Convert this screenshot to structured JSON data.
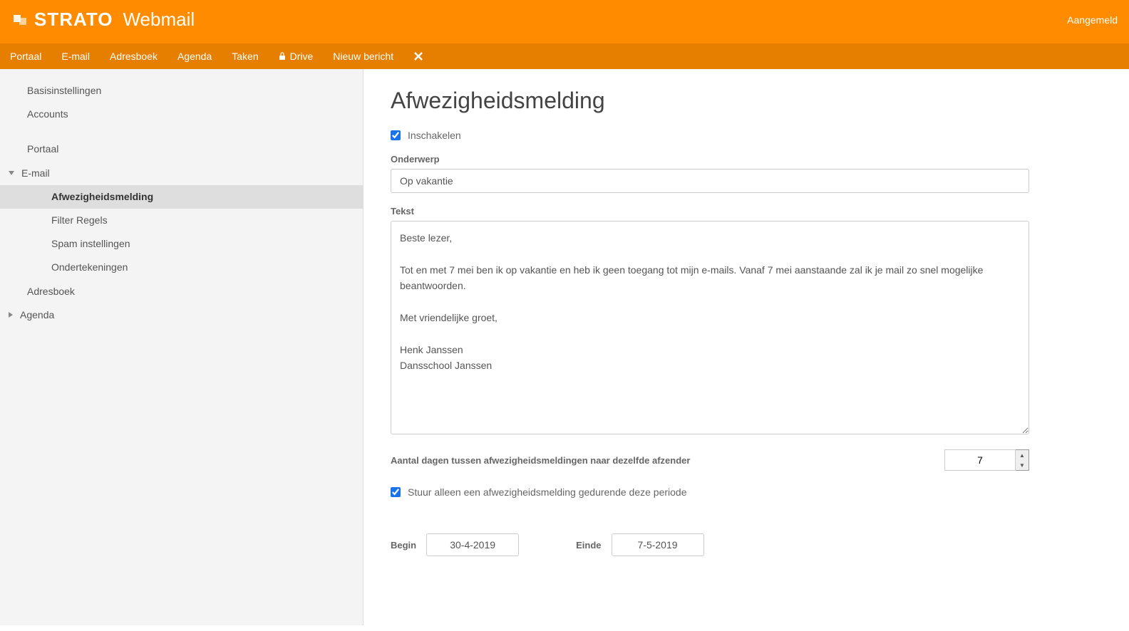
{
  "header": {
    "brand": "STRATO",
    "product": "Webmail",
    "logged_in": "Aangemeld"
  },
  "nav": {
    "items": [
      "Portaal",
      "E-mail",
      "Adresboek",
      "Agenda",
      "Taken"
    ],
    "drive": "Drive",
    "new_message": "Nieuw bericht"
  },
  "sidebar": {
    "basis": "Basisinstellingen",
    "accounts": "Accounts",
    "portaal": "Portaal",
    "email": "E-mail",
    "email_sub": {
      "afwezig": "Afwezigheidsmelding",
      "filter": "Filter Regels",
      "spam": "Spam instellingen",
      "ondertek": "Ondertekeningen"
    },
    "adresboek": "Adresboek",
    "agenda": "Agenda"
  },
  "main": {
    "title": "Afwezigheidsmelding",
    "enable_label": "Inschakelen",
    "subject_label": "Onderwerp",
    "subject_value": "Op vakantie",
    "text_label": "Tekst",
    "text_value": "Beste lezer,\n\nTot en met 7 mei ben ik op vakantie en heb ik geen toegang tot mijn e-mails. Vanaf 7 mei aanstaande zal ik je mail zo snel mogelijke beantwoorden.\n\nMet vriendelijke groet,\n\nHenk Janssen\nDansschool Janssen",
    "days_label": "Aantal dagen tussen afwezigheidsmeldingen naar dezelfde afzender",
    "days_value": "7",
    "period_label": "Stuur alleen een afwezigheidsmelding gedurende deze periode",
    "begin_label": "Begin",
    "begin_value": "30-4-2019",
    "einde_label": "Einde",
    "einde_value": "7-5-2019"
  }
}
